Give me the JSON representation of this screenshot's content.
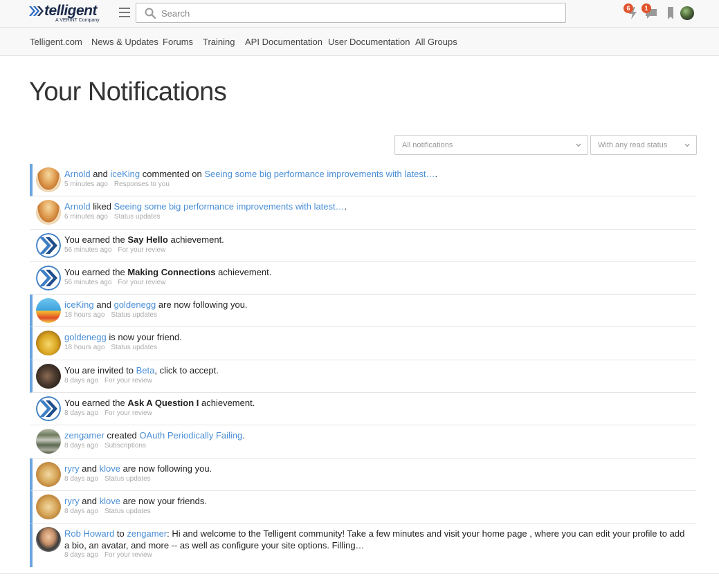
{
  "brand": {
    "name": "telligent",
    "tagline": "A VERINT Company",
    "color": "#1b2a4a"
  },
  "header": {
    "search_placeholder": "Search",
    "notifications_badge": "6",
    "messages_badge": "1",
    "accent_badge_color": "#e0542e"
  },
  "nav": {
    "items": [
      "Telligent.com",
      "News & Updates",
      "Forums",
      "Training",
      "API Documentation",
      "User Documentation",
      "All Groups"
    ]
  },
  "page": {
    "title": "Your Notifications"
  },
  "filters": {
    "type": "All notifications",
    "read_status": "With any read status"
  },
  "link_color": "#4a8fd6",
  "unread_bar_color": "#6aa5e0",
  "notifications": [
    {
      "unread": true,
      "avatar": "pancake",
      "parts": [
        "Arnold",
        " and ",
        "iceKing",
        " commented on ",
        "Seeing some big performance improvements with latest…",
        "."
      ],
      "time": "5 minutes ago",
      "category": "Responses to you"
    },
    {
      "unread": false,
      "avatar": "pancake",
      "parts": [
        "Arnold",
        " liked ",
        "Seeing some big performance improvements with latest…",
        "."
      ],
      "time": "6 minutes ago",
      "category": "Status updates"
    },
    {
      "unread": false,
      "avatar": "achievement",
      "parts": [
        "You earned the ",
        "Say Hello",
        " achievement."
      ],
      "time": "56 minutes ago",
      "category": "For your review"
    },
    {
      "unread": false,
      "avatar": "achievement",
      "parts": [
        "You earned the ",
        "Making Connections",
        " achievement."
      ],
      "time": "56 minutes ago",
      "category": "For your review"
    },
    {
      "unread": true,
      "avatar": "crown",
      "parts": [
        "iceKing",
        " and ",
        "goldenegg",
        " are now following you."
      ],
      "time": "18 hours ago",
      "category": "Status updates"
    },
    {
      "unread": true,
      "avatar": "egg",
      "parts": [
        "goldenegg",
        " is now your friend."
      ],
      "time": "18 hours ago",
      "category": "Status updates"
    },
    {
      "unread": true,
      "avatar": "beta",
      "parts": [
        "You are invited to ",
        "Beta",
        ", click to accept."
      ],
      "time": "8 days ago",
      "category": "For your review"
    },
    {
      "unread": false,
      "avatar": "achievement",
      "parts": [
        "You earned the ",
        "Ask A Question I",
        " achievement."
      ],
      "time": "8 days ago",
      "category": "For your review"
    },
    {
      "unread": false,
      "avatar": "stones",
      "parts": [
        "zengamer",
        " created ",
        "OAuth Periodically Failing",
        "."
      ],
      "time": "8 days ago",
      "category": "Subscriptions"
    },
    {
      "unread": true,
      "avatar": "doge",
      "parts": [
        "ryry",
        " and ",
        "klove",
        " are now following you."
      ],
      "time": "8 days ago",
      "category": "Status updates"
    },
    {
      "unread": true,
      "avatar": "doge",
      "parts": [
        "ryry",
        " and ",
        "klove",
        " are now your friends."
      ],
      "time": "8 days ago",
      "category": "Status updates"
    },
    {
      "unread": true,
      "avatar": "rob",
      "parts": [
        "Rob Howard",
        " to ",
        "zengamer",
        ": Hi and welcome to the Telligent community! Take a few minutes and visit your home page , where you can edit your profile to add a bio, an avatar, and more -- as well as configure your site options. Filling…"
      ],
      "time": "8 days ago",
      "category": "For your review"
    }
  ]
}
